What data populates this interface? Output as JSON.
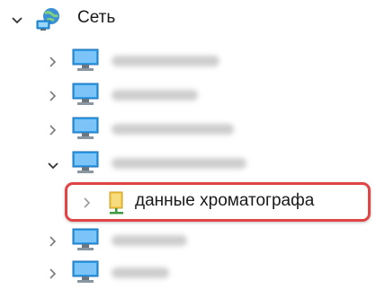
{
  "tree": {
    "root": {
      "label": "Сеть",
      "expanded": true,
      "icon": "network-icon"
    },
    "computers": [
      {
        "name_visible": false,
        "expanded": false,
        "icon": "computer-icon"
      },
      {
        "name_visible": false,
        "expanded": false,
        "icon": "computer-icon"
      },
      {
        "name_visible": false,
        "expanded": false,
        "icon": "computer-icon"
      },
      {
        "name_visible": false,
        "expanded": true,
        "icon": "computer-icon"
      },
      {
        "name_visible": false,
        "expanded": false,
        "icon": "computer-icon"
      },
      {
        "name_visible": false,
        "expanded": false,
        "icon": "computer-icon"
      }
    ],
    "shared_folder": {
      "label": "данные хроматографа",
      "expanded": false,
      "icon": "shared-folder-icon",
      "highlighted": true
    }
  },
  "colors": {
    "highlight_border": "#e04444",
    "monitor_blue": "#2f9ee8",
    "folder_yellow": "#f2c94c",
    "share_green": "#3c9a3c",
    "chevron_gray": "#7a7a7a"
  }
}
